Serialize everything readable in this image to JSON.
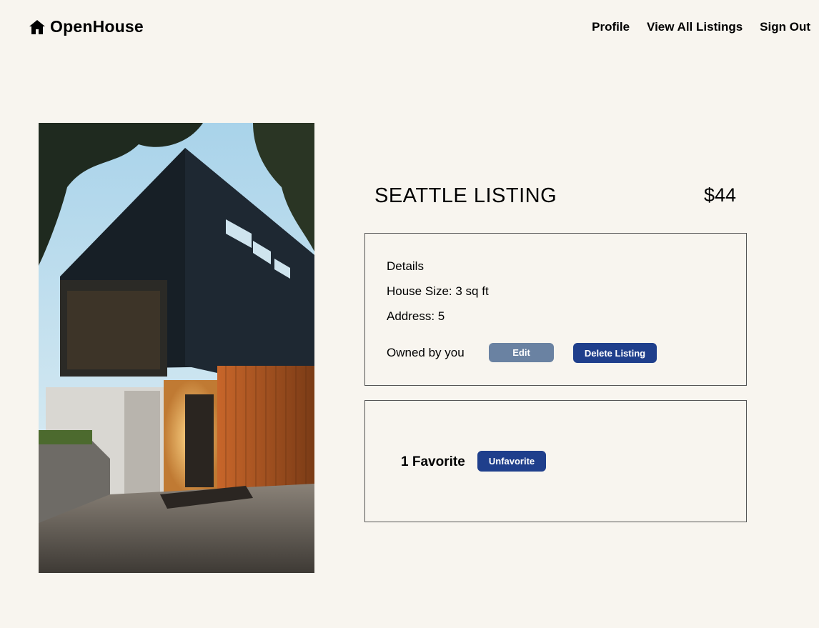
{
  "header": {
    "brand": "OpenHouse",
    "nav": [
      "Profile",
      "View All Listings",
      "Sign Out"
    ]
  },
  "listing": {
    "title": "SEATTLE LISTING",
    "price": "$44",
    "details_heading": "Details",
    "house_size": "House Size: 3 sq ft",
    "address": "Address: 5",
    "owned_text": "Owned by you",
    "edit_label": "Edit",
    "delete_label": "Delete Listing"
  },
  "favorites": {
    "count_text": "1 Favorite",
    "unfavorite_label": "Unfavorite"
  },
  "colors": {
    "background": "#f8f5ef",
    "edit_button": "#6a82a2",
    "primary_button": "#1f3f8c"
  },
  "icons": {
    "brand": "home-icon"
  }
}
